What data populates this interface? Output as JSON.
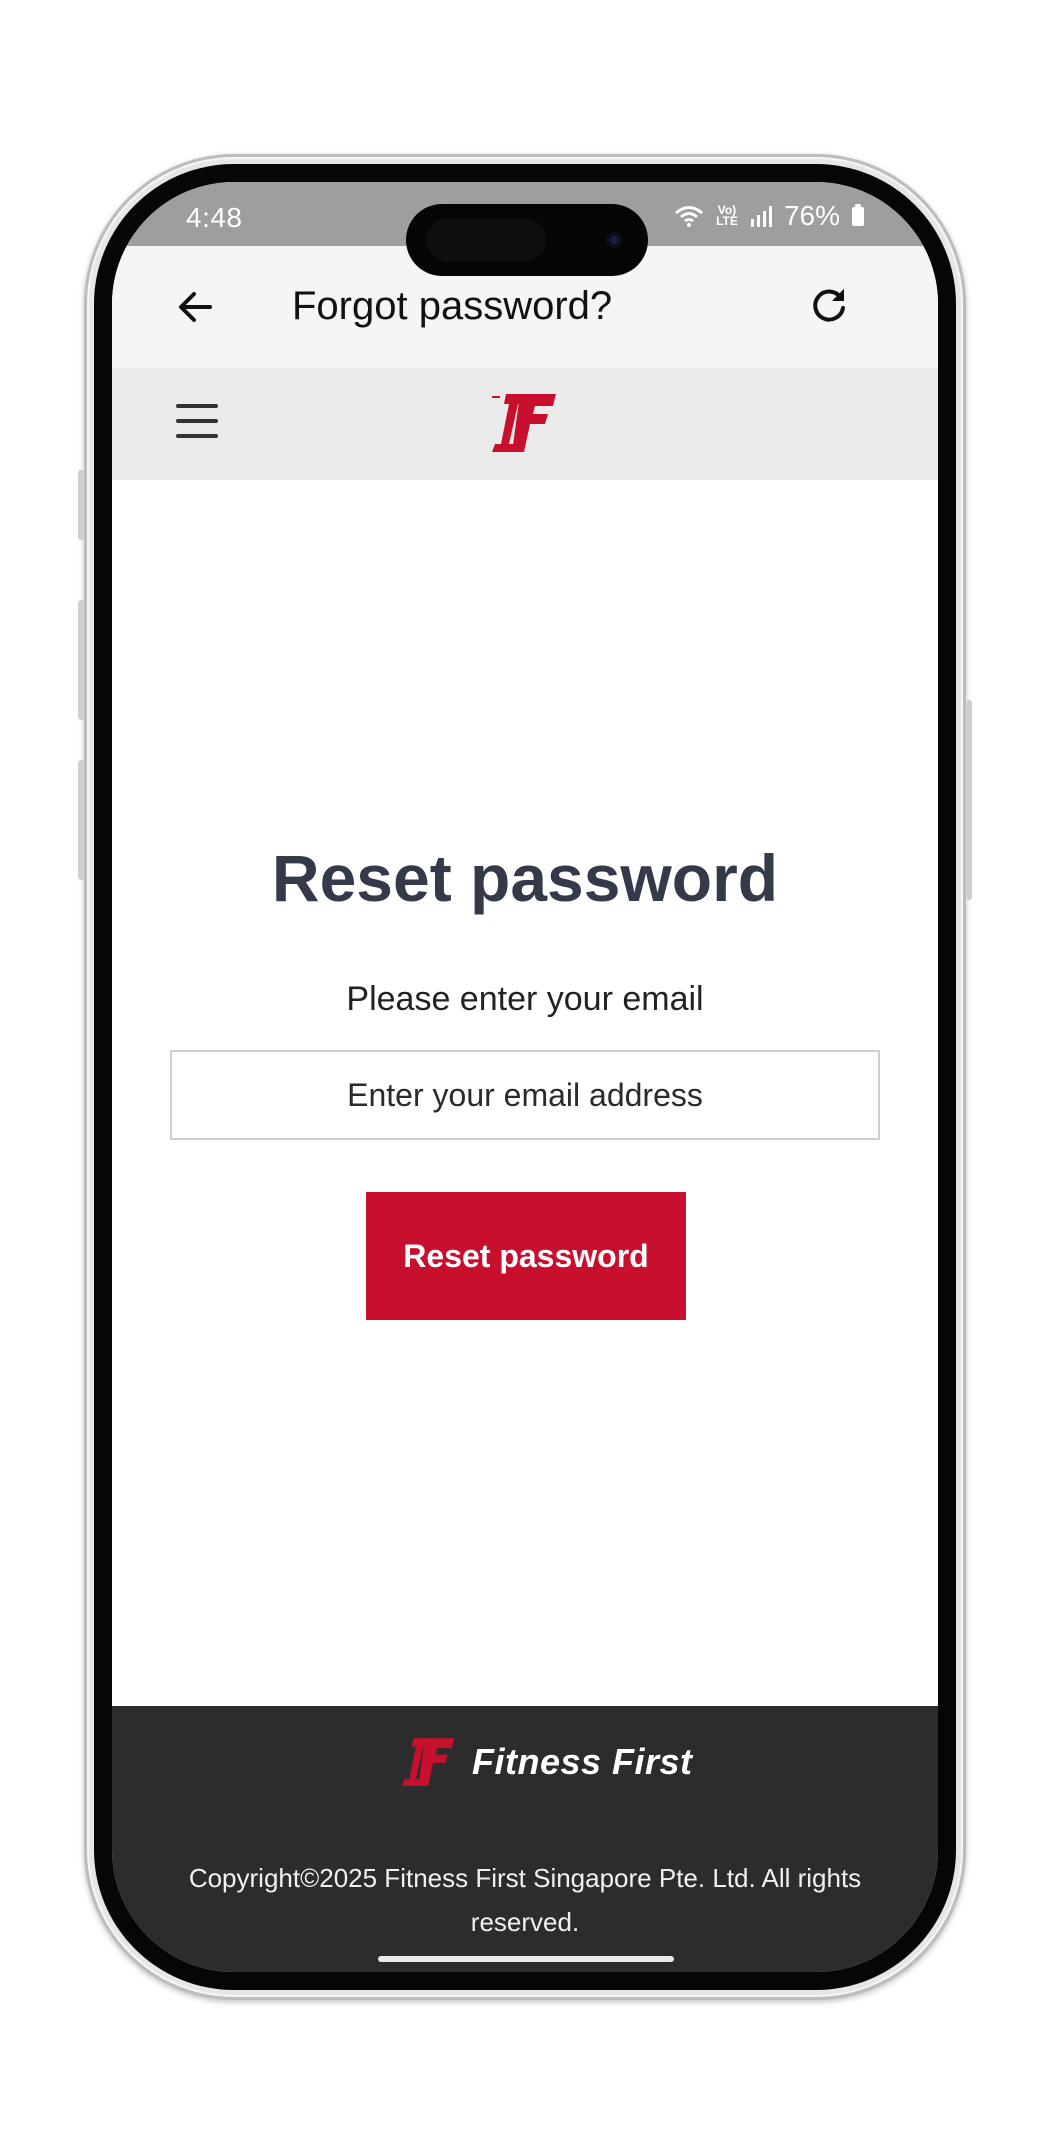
{
  "status_bar": {
    "time": "4:48",
    "network_label": "Vo) LTE",
    "battery": "76%"
  },
  "app_bar": {
    "title": "Forgot password?"
  },
  "main": {
    "heading": "Reset password",
    "instruction": "Please enter your email",
    "email_placeholder": "Enter your email address",
    "email_value": "",
    "submit_label": "Reset password"
  },
  "footer": {
    "brand_name": "Fitness First",
    "copyright": "Copyright©2025 Fitness First Singapore Pte. Ltd. All rights reserved."
  },
  "colors": {
    "brand_red": "#c8102e",
    "heading": "#353a4a",
    "footer_bg": "#2c2c2c",
    "header_bg": "#ebebeb"
  },
  "icons": [
    "arrow-left-icon",
    "reload-icon",
    "menu-icon",
    "fitness-first-logo",
    "wifi-icon",
    "signal-icon",
    "battery-icon"
  ]
}
